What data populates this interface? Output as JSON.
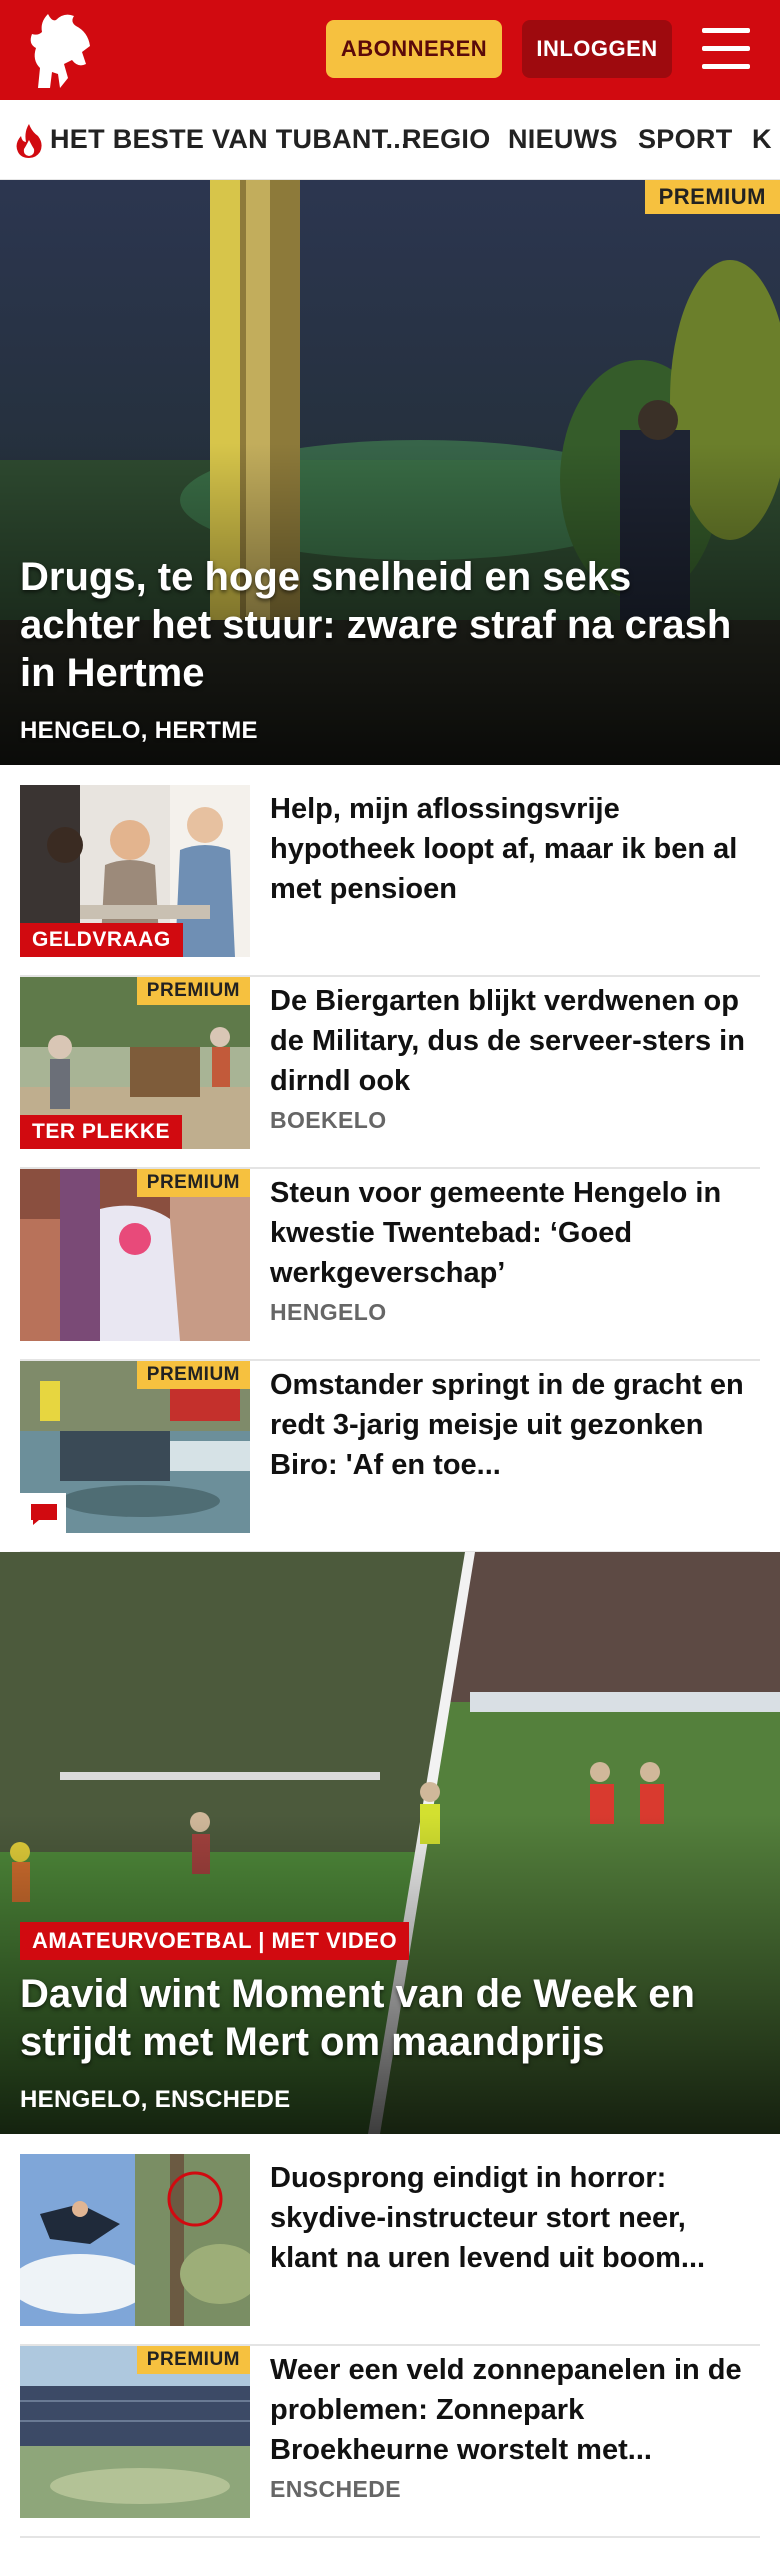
{
  "header": {
    "subscribe_label": "ABONNEREN",
    "login_label": "INLOGGEN",
    "brand_color": "#d10a10",
    "logo_icon": "horse-icon",
    "menu_icon": "hamburger-icon"
  },
  "nav": {
    "trending_icon": "flame-icon",
    "items": [
      "HET BESTE VAN TUBANT...",
      "REGIO",
      "NIEUWS",
      "SPORT",
      "K"
    ]
  },
  "hero": {
    "badge": "PREMIUM",
    "title": "Drugs, te hoge snelheid en seks achter het stuur: zware straf na crash in Hertme",
    "location": "HENGELO, HERTME"
  },
  "articles": [
    {
      "title": "Help, mijn aflossingsvrije hypotheek loopt af, maar ik ben al met pensioen",
      "category": "GELDVRAAG",
      "premium": "",
      "location": ""
    },
    {
      "title": "De Biergarten blijkt verdwenen op de Military, dus de serveer-sters in dirndl ook",
      "category": "TER PLEKKE",
      "premium": "PREMIUM",
      "location": "BOEKELO"
    },
    {
      "title": "Steun voor gemeente Hengelo in kwestie Twentebad: ‘Goed werkgeverschap’",
      "category": "",
      "premium": "PREMIUM",
      "location": "HENGELO"
    },
    {
      "title": "Omstander springt in de gracht en redt 3-jarig meisje uit gezonken Biro: 'Af en toe...",
      "category": "",
      "premium": "PREMIUM",
      "location": "",
      "comment_icon": "comment-icon"
    }
  ],
  "hero2": {
    "category": "AMATEURVOETBAL | MET VIDEO",
    "title": "David wint Moment van de Week en strijdt met Mert om maandprijs",
    "location": "HENGELO, ENSCHEDE"
  },
  "articles2": [
    {
      "title": "Duosprong eindigt in horror: skydive-instructeur stort neer, klant na uren levend uit boom...",
      "premium": "",
      "location": ""
    },
    {
      "title": "Weer een veld zonnepanelen in de problemen: Zonnepark Broekheurne worstelt met...",
      "premium": "PREMIUM",
      "location": "ENSCHEDE"
    }
  ]
}
